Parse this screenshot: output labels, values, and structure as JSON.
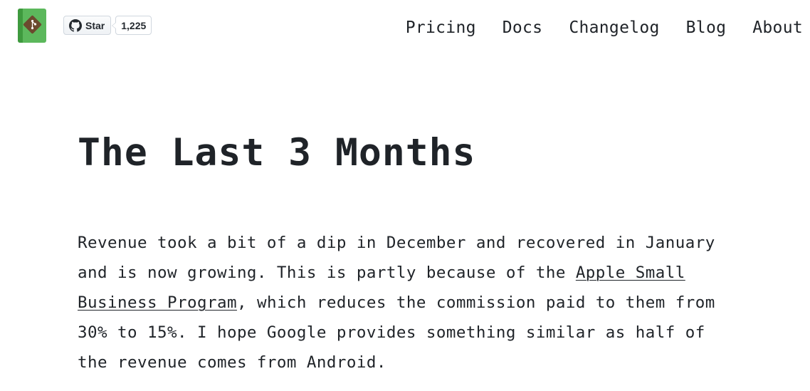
{
  "header": {
    "logo_icon": "git-book-logo-icon",
    "github": {
      "icon": "github-icon",
      "star_label": "Star",
      "star_count": "1,225"
    },
    "nav": [
      {
        "label": "Pricing"
      },
      {
        "label": "Docs"
      },
      {
        "label": "Changelog"
      },
      {
        "label": "Blog"
      },
      {
        "label": "About"
      }
    ]
  },
  "article": {
    "title": "The Last 3 Months",
    "paragraph": {
      "text_before_link": "Revenue took a bit of a dip in December and recovered in January\nand is now growing. This is partly because of the ",
      "link_text": "Apple Small\nBusiness Program",
      "text_after_link": ", which reduces the commission paid to them from\n30% to 15%. I hope Google provides something similar as half of\nthe revenue comes from Android."
    }
  },
  "colors": {
    "logo_green": "#5cb85c",
    "logo_brown": "#6b4a2e",
    "text": "#1f2328"
  }
}
